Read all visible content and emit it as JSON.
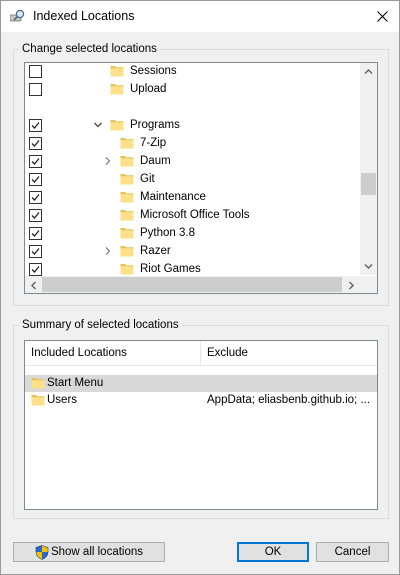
{
  "window": {
    "title": "Indexed Locations",
    "icon": "indexing-magnifier-icon"
  },
  "change_group": {
    "label": "Change selected locations",
    "tree": [
      {
        "label": "Sessions",
        "checked": false,
        "indent": 1,
        "expander": "none"
      },
      {
        "label": "Upload",
        "checked": false,
        "indent": 1,
        "expander": "none"
      },
      {
        "label": "",
        "checked": null,
        "indent": 0,
        "expander": "none"
      },
      {
        "label": "Programs",
        "checked": true,
        "indent": 1,
        "expander": "expanded"
      },
      {
        "label": "7-Zip",
        "checked": true,
        "indent": 2,
        "expander": "none"
      },
      {
        "label": "Daum",
        "checked": true,
        "indent": 2,
        "expander": "collapsed"
      },
      {
        "label": "Git",
        "checked": true,
        "indent": 2,
        "expander": "none"
      },
      {
        "label": "Maintenance",
        "checked": true,
        "indent": 2,
        "expander": "none"
      },
      {
        "label": "Microsoft Office Tools",
        "checked": true,
        "indent": 2,
        "expander": "none"
      },
      {
        "label": "Python 3.8",
        "checked": true,
        "indent": 2,
        "expander": "none"
      },
      {
        "label": "Razer",
        "checked": true,
        "indent": 2,
        "expander": "collapsed"
      },
      {
        "label": "Riot Games",
        "checked": true,
        "indent": 2,
        "expander": "none"
      }
    ]
  },
  "summary_group": {
    "label": "Summary of selected locations",
    "columns": {
      "included": "Included Locations",
      "exclude": "Exclude"
    },
    "rows": [
      {
        "included": "Start Menu",
        "exclude": "",
        "selected": true
      },
      {
        "included": "Users",
        "exclude": "AppData; eliasbenb.github.io; ...",
        "selected": false
      }
    ]
  },
  "buttons": {
    "show_all": "Show all locations",
    "ok": "OK",
    "cancel": "Cancel"
  },
  "colors": {
    "folder": "#ffe08a",
    "folder_dark": "#e6c35a",
    "selection": "#d9d9d9",
    "accent": "#0078d7"
  }
}
